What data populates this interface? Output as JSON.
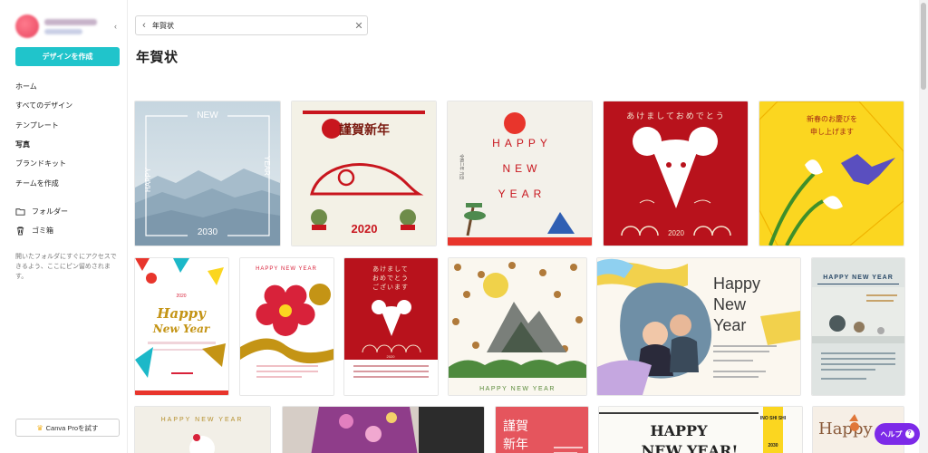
{
  "sidebar": {
    "create_button": "デザインを作成",
    "nav_items": [
      "ホーム",
      "すべてのデザイン",
      "テンプレート",
      "写真",
      "ブランドキット",
      "チームを作成"
    ],
    "folder_label": "フォルダー",
    "trash_label": "ゴミ箱",
    "hint_text": "開いたフォルダにすぐにアクセスできるよう、ここにピン留めされます。",
    "pro_button": "Canva Proを試す"
  },
  "search": {
    "value": "年賀状"
  },
  "page_title": "年賀状",
  "help_button": "ヘルプ",
  "help_icon_glyph": "?",
  "cards": {
    "c1": {
      "top": "NEW",
      "left": "HAPPY",
      "right": "YEAR",
      "bottom": "2030"
    },
    "c2": {
      "title": "謹賀新年",
      "year": "2020"
    },
    "c3": {
      "side": "令和二年 元旦",
      "line1": "HAPPY",
      "line2": "NEW",
      "line3": "YEAR"
    },
    "c4": {
      "title": "あけましておめでとう",
      "year": "2020"
    },
    "c5": {
      "line1": "新春のお慶びを",
      "line2": "申し上げます"
    },
    "c6": {
      "year": "2020",
      "line1": "Happy",
      "line2": "New Year"
    },
    "c7": {
      "title": "HAPPY NEW YEAR"
    },
    "c8": {
      "line1": "あけまして",
      "line2": "おめでとう",
      "line3": "ございます",
      "year": "2020"
    },
    "c9": {
      "title": "HAPPY NEW YEAR"
    },
    "c10": {
      "line1": "Happy",
      "line2": "New",
      "line3": "Year"
    },
    "c11": {
      "title": "HAPPY NEW YEAR"
    },
    "c12": {
      "title": "HAPPY NEW YEAR"
    },
    "c14": {
      "line1": "謹賀",
      "line2": "新年"
    },
    "c15": {
      "line1": "HAPPY",
      "line2": "NEW YEAR!",
      "tag": "INO SHI SHI",
      "year": "2030"
    },
    "c16": {
      "title": "Happy"
    }
  },
  "colors": {
    "accent_teal": "#20c4cb",
    "help_purple": "#7d2ae8",
    "card_red": "#c8161e"
  }
}
